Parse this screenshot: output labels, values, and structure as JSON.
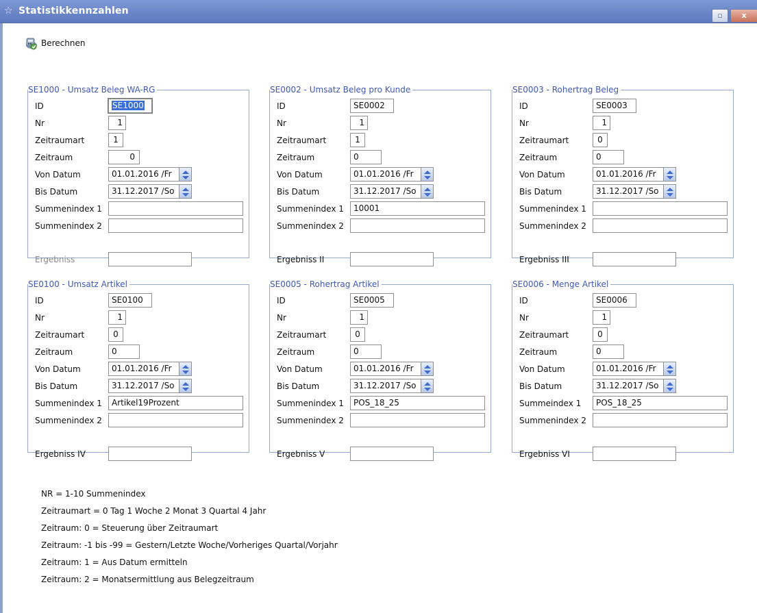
{
  "window": {
    "title": "Statistikkennzahlen",
    "restore_label": "▫",
    "close_label": "x"
  },
  "toolbar": {
    "calculate_label": "Berechnen"
  },
  "panels": [
    {
      "title": "SE1000 - Umsatz Beleg WA-RG",
      "id_label": "ID",
      "id_value": "SE1000",
      "id_selected": true,
      "nr_label": "Nr",
      "nr_value": "1",
      "zeitraumart_label": "Zeitraumart",
      "zeitraumart_value": "1",
      "zeitraum_label": "Zeitraum",
      "zeitraum_value": "0",
      "von_label": "Von Datum",
      "von_value": "01.01.2016 /Fr",
      "bis_label": "Bis Datum",
      "bis_value": "31.12.2017 /So",
      "sum1_label": "Summenindex 1",
      "sum1_value": "",
      "sum2_label": "Summenindex 2",
      "sum2_value": "",
      "result_label": "Ergebniss",
      "result_value": "",
      "result_disabled": true
    },
    {
      "title": "SE0002 - Umsatz Beleg pro Kunde",
      "id_label": "ID",
      "id_value": "SE0002",
      "nr_label": "Nr",
      "nr_value": "1",
      "zeitraumart_label": "Zeitraumart",
      "zeitraumart_value": "1",
      "zeitraum_label": "Zeitraum",
      "zeitraum_value": "0",
      "von_label": "Von Datum",
      "von_value": "01.01.2016 /Fr",
      "bis_label": "Bis Datum",
      "bis_value": "31.12.2017 /So",
      "sum1_label": "Summenindex 1",
      "sum1_value": "10001",
      "sum2_label": "Summenindex 2",
      "sum2_value": "",
      "result_label": "Ergebniss II",
      "result_value": ""
    },
    {
      "title": "SE0003 - Rohertrag Beleg",
      "id_label": "ID",
      "id_value": "SE0003",
      "nr_label": "Nr",
      "nr_value": "1",
      "zeitraumart_label": "Zeitraumart",
      "zeitraumart_value": "0",
      "zeitraum_label": "Zeitraum",
      "zeitraum_value": "0",
      "von_label": "Von Datum",
      "von_value": "01.01.2016 /Fr",
      "bis_label": "Bis Datum",
      "bis_value": "31.12.2017 /So",
      "sum1_label": "Summenindex 1",
      "sum1_value": "",
      "sum2_label": "Summenindex 2",
      "sum2_value": "",
      "result_label": "Ergebniss III",
      "result_value": ""
    },
    {
      "title": "SE0100 - Umsatz Artikel",
      "id_label": "ID",
      "id_value": "SE0100",
      "nr_label": "Nr",
      "nr_value": "1",
      "zeitraumart_label": "Zeitraumart",
      "zeitraumart_value": "0",
      "zeitraum_label": "Zeitraum",
      "zeitraum_value": "0",
      "von_label": "Von Datum",
      "von_value": "01.01.2016 /Fr",
      "bis_label": "Bis Datum",
      "bis_value": "31.12.2017 /So",
      "sum1_label": "Summenindex 1",
      "sum1_value": "Artikel19Prozent",
      "sum2_label": "Summenindex 2",
      "sum2_value": "",
      "result_label": "Ergebniss IV",
      "result_value": ""
    },
    {
      "title": "SE0005 - Rohertrag Artikel",
      "id_label": "ID",
      "id_value": "SE0005",
      "nr_label": "Nr",
      "nr_value": "1",
      "zeitraumart_label": "Zeitraumart",
      "zeitraumart_value": "0",
      "zeitraum_label": "Zeitraum",
      "zeitraum_value": "0",
      "von_label": "Von Datum",
      "von_value": "01.01.2016 /Fr",
      "bis_label": "Bis Datum",
      "bis_value": "31.12.2017 /So",
      "sum1_label": "Summenindex 1",
      "sum1_value": "POS_18_25",
      "sum2_label": "Summenindex 2",
      "sum2_value": "",
      "result_label": "Ergebniss V",
      "result_value": ""
    },
    {
      "title": "SE0006 - Menge Artikel",
      "id_label": "ID",
      "id_value": "SE0006",
      "nr_label": "Nr",
      "nr_value": "1",
      "zeitraumart_label": "Zeitraumart",
      "zeitraumart_value": "0",
      "zeitraum_label": "Zeitraum",
      "zeitraum_value": "0",
      "von_label": "Von Datum",
      "von_value": "01.01.2016 /Fr",
      "bis_label": "Bis Datum",
      "bis_value": "31.12.2017 /So",
      "sum1_label": "Summeindex 1",
      "sum1_value": "POS_18_25",
      "sum2_label": "Summenindex 2",
      "sum2_value": "",
      "result_label": "Ergebniss VI",
      "result_value": ""
    }
  ],
  "notes": [
    "NR = 1-10 Summenindex",
    "Zeitraumart = 0 Tag 1 Woche 2 Monat 3 Quartal 4 Jahr",
    "Zeitraum: 0 = Steuerung über Zeitraumart",
    "Zeitraum: -1 bis -99 = Gestern/Letzte Woche/Vorheriges Quartal/Vorjahr",
    "Zeitraum: 1 = Aus Datum ermitteln",
    "Zeitraum: 2 = Monatsermittlung aus Belegzeitraum"
  ],
  "colors": {
    "titlebar": "#6a86c8",
    "panel_border": "#94a8d6",
    "panel_title": "#3f58b8",
    "selection": "#3a6fd8"
  }
}
